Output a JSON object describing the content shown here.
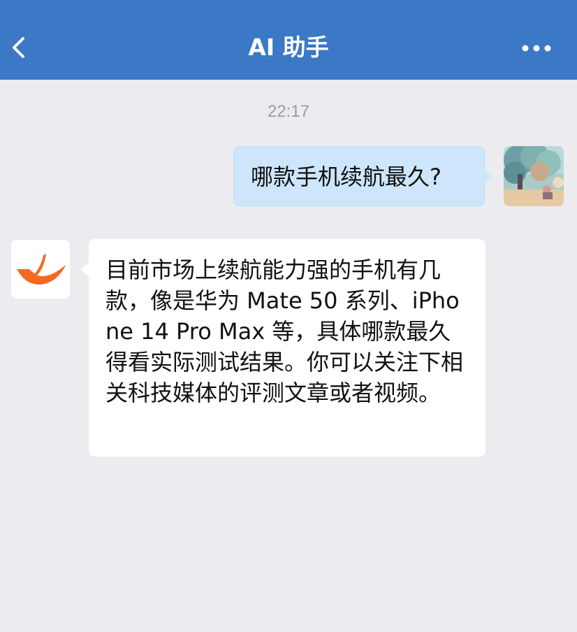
{
  "header": {
    "title": "AI 助手",
    "back_icon": "chevron-left-icon",
    "more_icon": "more-horizontal-icon",
    "background_color": "#3b78c6"
  },
  "conversation": {
    "timestamp": "22:17",
    "messages": [
      {
        "sender": "user",
        "text": "哪款手机续航最久?",
        "bubble_color": "#cde6fb"
      },
      {
        "sender": "assistant",
        "text": "目前市场上续航能力强的手机有几款，像是华为 Mate 50 系列、iPhone 14 Pro Max 等，具体哪款最久得看实际测试结果。你可以关注下相关科技媒体的评测文章或者视频。",
        "bubble_color": "#ffffff",
        "avatar_color": "#f26a21"
      }
    ]
  }
}
